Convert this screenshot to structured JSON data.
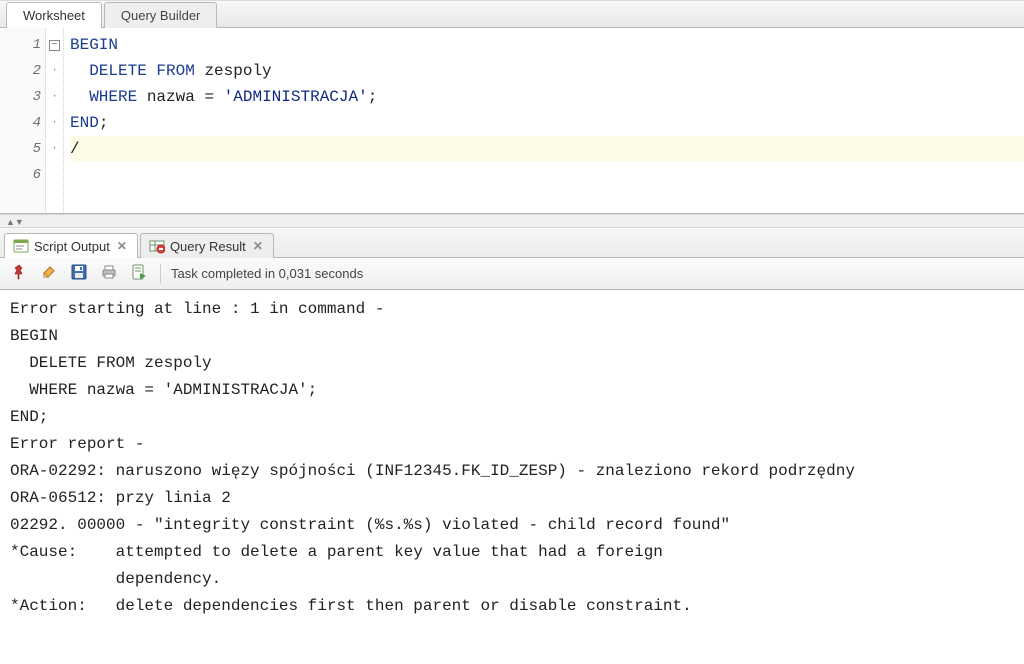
{
  "editorTabs": {
    "worksheet": "Worksheet",
    "queryBuilder": "Query Builder"
  },
  "code": {
    "lineNumbers": [
      "1",
      "2",
      "3",
      "4",
      "5",
      "6"
    ],
    "lines": [
      {
        "type": "begin",
        "kw": "BEGIN"
      },
      {
        "type": "delete",
        "kw1": "DELETE",
        "kw2": "FROM",
        "ident": "zespoly"
      },
      {
        "type": "where",
        "kw": "WHERE",
        "ident": "nazwa",
        "op": "=",
        "str": "'ADMINISTRACJA'",
        "term": ";"
      },
      {
        "type": "end",
        "kw": "END",
        "term": ";"
      },
      {
        "type": "slash",
        "text": "/"
      },
      {
        "type": "blank",
        "text": ""
      }
    ]
  },
  "outputTabs": {
    "scriptOutput": "Script Output",
    "queryResult": "Query Result"
  },
  "toolbar": {
    "status": "Task completed in 0,031 seconds"
  },
  "scriptOutputText": "Error starting at line : 1 in command -\nBEGIN\n  DELETE FROM zespoly\n  WHERE nazwa = 'ADMINISTRACJA';\nEND;\nError report -\nORA-02292: naruszono więzy spójności (INF12345.FK_ID_ZESP) - znaleziono rekord podrzędny\nORA-06512: przy linia 2\n02292. 00000 - \"integrity constraint (%s.%s) violated - child record found\"\n*Cause:    attempted to delete a parent key value that had a foreign\n           dependency.\n*Action:   delete dependencies first then parent or disable constraint."
}
